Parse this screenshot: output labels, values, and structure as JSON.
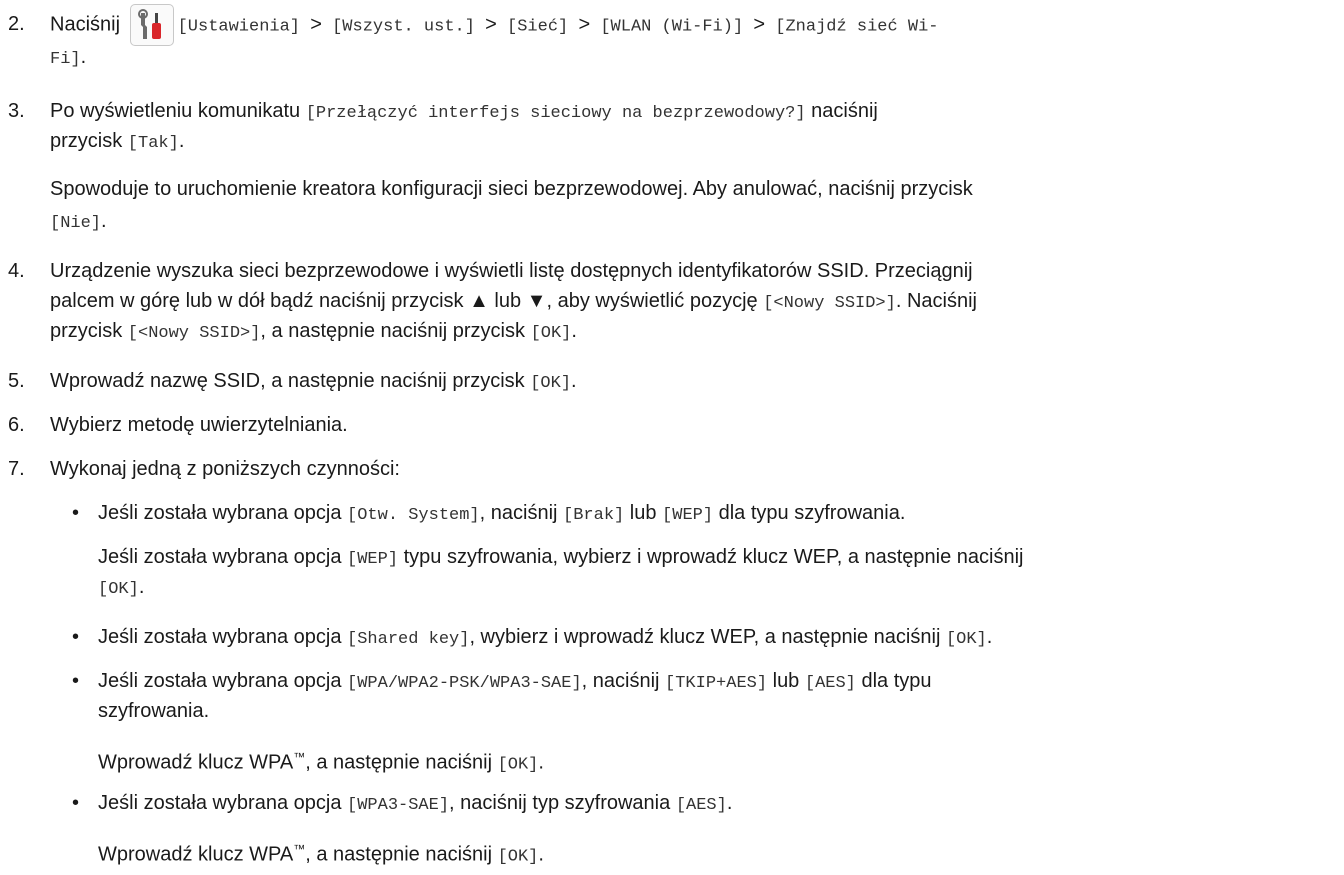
{
  "steps": {
    "s2": {
      "num": "2.",
      "text": "Naciśnij",
      "path_a": "[Ustawienia] ",
      "sep": ">",
      "path_b": " [Wszyst. ust.] ",
      "path_c": " [Sieć] ",
      "path_d": " [WLAN (Wi-Fi)] ",
      "path_e": " [Znajdź sieć Wi-",
      "path_f": "Fi]",
      "end": "."
    },
    "s3": {
      "num": "3.",
      "t1": "Po wyświetleniu komunikatu ",
      "m1": "[Przełączyć interfejs sieciowy na bezprzewodowy?]",
      "t2": " naciśnij",
      "t3": "przycisk ",
      "m2": "[Tak]",
      "t4": ".",
      "p1": "Spowoduje to uruchomienie kreatora konfiguracji sieci bezprzewodowej. Aby anulować, naciśnij przycisk",
      "m3": "[Nie]",
      "p2": "."
    },
    "s4": {
      "num": "4.",
      "l1": "Urządzenie wyszuka sieci bezprzewodowe i wyświetli listę dostępnych identyfikatorów SSID. Przeciągnij",
      "l2a": "palcem w górę lub w dół bądź naciśnij przycisk ▲ lub ▼, aby wyświetlić pozycję ",
      "l2m": "[<Nowy SSID>]",
      "l2b": ". Naciśnij",
      "l3a": "przycisk ",
      "l3m": "[<Nowy SSID>]",
      "l3b": ", a następnie naciśnij przycisk ",
      "l3m2": "[OK]",
      "l3c": "."
    },
    "s5": {
      "num": "5.",
      "t": "Wprowadź nazwę SSID, a następnie naciśnij przycisk ",
      "m": "[OK]",
      "e": "."
    },
    "s6": {
      "num": "6.",
      "t": "Wybierz metodę uwierzytelniania."
    },
    "s7": {
      "num": "7.",
      "t": "Wykonaj jedną z poniższych czynności:"
    }
  },
  "bullets": {
    "b1": {
      "t1": "Jeśli została wybrana opcja ",
      "m1": "[Otw. System]",
      "t2": ", naciśnij ",
      "m2": "[Brak]",
      "t3": " lub ",
      "m3": "[WEP]",
      "t4": " dla typu szyfrowania.",
      "p1": "Jeśli została wybrana opcja ",
      "pm1": "[WEP]",
      "p2": " typu szyfrowania, wybierz i wprowadź klucz WEP, a następnie naciśnij",
      "pm2": "[OK]",
      "p3": "."
    },
    "b2": {
      "t1": "Jeśli została wybrana opcja ",
      "m1": "[Shared key]",
      "t2": ", wybierz i wprowadź klucz WEP, a następnie naciśnij ",
      "m2": "[OK]",
      "t3": "."
    },
    "b3": {
      "t1": "Jeśli została wybrana opcja ",
      "m1": "[WPA/WPA2-PSK/WPA3-SAE]",
      "t2": ", naciśnij ",
      "m2": "[TKIP+AES]",
      "t3": " lub ",
      "m3": "[AES]",
      "t4": " dla typu",
      "t5": "szyfrowania.",
      "p1": "Wprowadź klucz WPA",
      "tm": "™",
      "p2": ", a następnie naciśnij ",
      "pm": "[OK]",
      "p3": "."
    },
    "b4": {
      "t1": "Jeśli została wybrana opcja ",
      "m1": "[WPA3-SAE]",
      "t2": ", naciśnij typ szyfrowania ",
      "m2": "[AES]",
      "t3": ".",
      "p1": "Wprowadź klucz WPA",
      "tm": "™",
      "p2": ", a następnie naciśnij ",
      "pm": "[OK]",
      "p3": "."
    }
  },
  "bullet_char": "•",
  "icon": {
    "name": "settings-tools-icon"
  },
  "colors": {
    "text": "#1a1a1a",
    "mono": "#333333",
    "icon_red": "#d9262b",
    "icon_gray": "#6b6b6b"
  }
}
